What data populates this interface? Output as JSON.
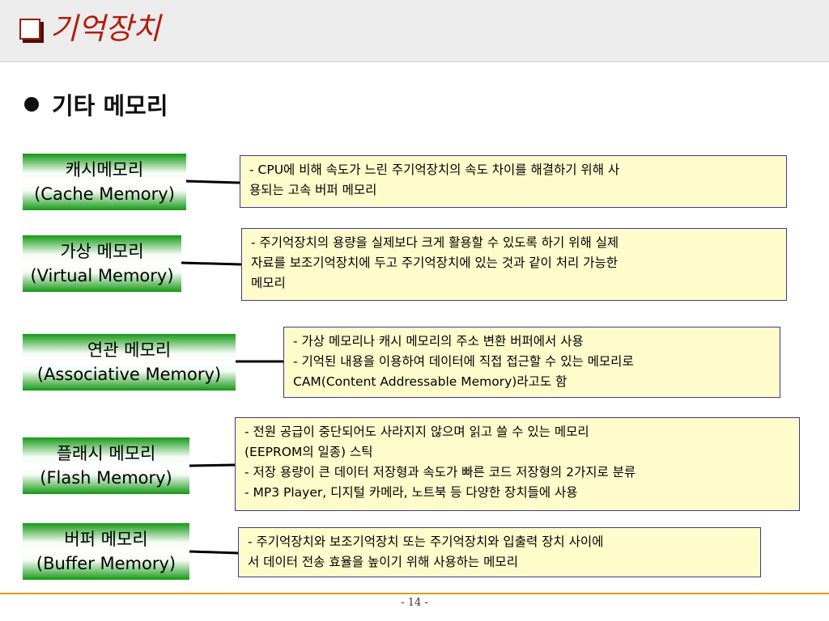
{
  "header": {
    "title": "기억장치",
    "icon": "checkbox-square-icon"
  },
  "section": {
    "title": "기타 메모리"
  },
  "items": [
    {
      "name": "캐시메모리",
      "english": "(Cache Memory)",
      "desc": [
        "- CPU에 비해 속도가 느린 주기억장치의 속도 차이를 해결하기 위해 사",
        "용되는 고속 버퍼 메모리"
      ]
    },
    {
      "name": "가상 메모리",
      "english": "(Virtual Memory)",
      "desc": [
        "- 주기억장치의 용량을 실제보다 크게 활용할 수 있도록 하기 위해 실제",
        "자료를 보조기억장치에 두고 주기억장치에 있는 것과 같이 처리 가능한",
        "메모리"
      ]
    },
    {
      "name": "연관 메모리",
      "english": "(Associative Memory)",
      "desc": [
        "- 가상 메모리나 캐시 메모리의 주소 변환 버퍼에서 사용",
        "- 기억된 내용을 이용하여 데이터에 직접 접근할 수 있는 메모리로",
        "CAM(Content Addressable Memory)라고도 함"
      ]
    },
    {
      "name": "플래시 메모리",
      "english": "(Flash Memory)",
      "desc": [
        "- 전원 공급이 중단되어도 사라지지 않으며 읽고 쓸 수 있는 메모리",
        "(EEPROM의 일종) 스틱",
        "- 저장 용량이 큰 데이터 저장형과 속도가 빠른 코드 저장형의 2가지로 분류",
        "- MP3 Player, 디지털 카메라, 노트북 등 다양한 장치들에 사용"
      ]
    },
    {
      "name": "버퍼 메모리",
      "english": "(Buffer Memory)",
      "desc": [
        "- 주기억장치와 보조기억장치 또는 주기억장치와 입출력 장치 사이에",
        "서 데이터 전송 효율을 높이기 위해 사용하는 메모리"
      ]
    }
  ],
  "footer": {
    "page": "- 14 -"
  },
  "colors": {
    "title": "#b01e10",
    "label_green": "#159915",
    "desc_bg": "#fffccc",
    "desc_border": "#3a3a9a",
    "footer_line": "#e0a000"
  }
}
